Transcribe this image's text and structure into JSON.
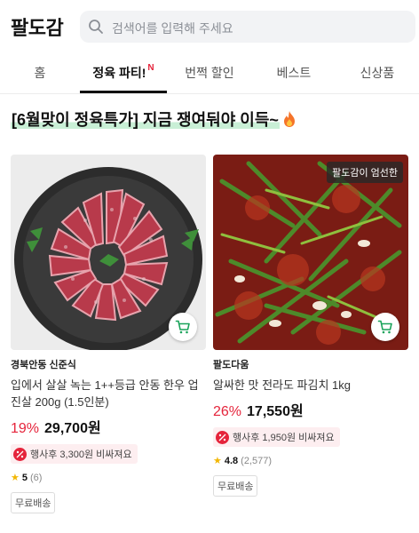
{
  "header": {
    "logo": "팔도감",
    "search_placeholder": "검색어를 입력해 주세요"
  },
  "tabs": [
    {
      "label": "홈",
      "active": false
    },
    {
      "label": "정육 파티!",
      "active": true,
      "new_mark": "N"
    },
    {
      "label": "번쩍 할인",
      "active": false
    },
    {
      "label": "베스트",
      "active": false
    },
    {
      "label": "신상품",
      "active": false
    }
  ],
  "promo": {
    "text": "[6월맞이 정육특가] 지금 쟁여둬야 이득~"
  },
  "products": [
    {
      "seller": "경북안동 신준식",
      "title": "입에서 살살 녹는 1++등급 안동 한우 업진살 200g (1.5인분)",
      "discount": "19%",
      "price": "29,700원",
      "coupon": "행사후 3,300원 비싸져요",
      "rating": "5",
      "review_count": "(6)",
      "shipping": "무료배송"
    },
    {
      "badge": "팔도감이 엄선한",
      "seller": "팔도다움",
      "title": "알싸한 맛 전라도 파김치 1kg",
      "discount": "26%",
      "price": "17,550원",
      "coupon": "행사후 1,950원 비싸져요",
      "rating": "4.8",
      "review_count": "(2,577)",
      "shipping": "무료배송"
    }
  ],
  "colors": {
    "accent_red": "#e5243b",
    "cart_green": "#1aa35a",
    "highlight_green": "#c9efd6"
  }
}
